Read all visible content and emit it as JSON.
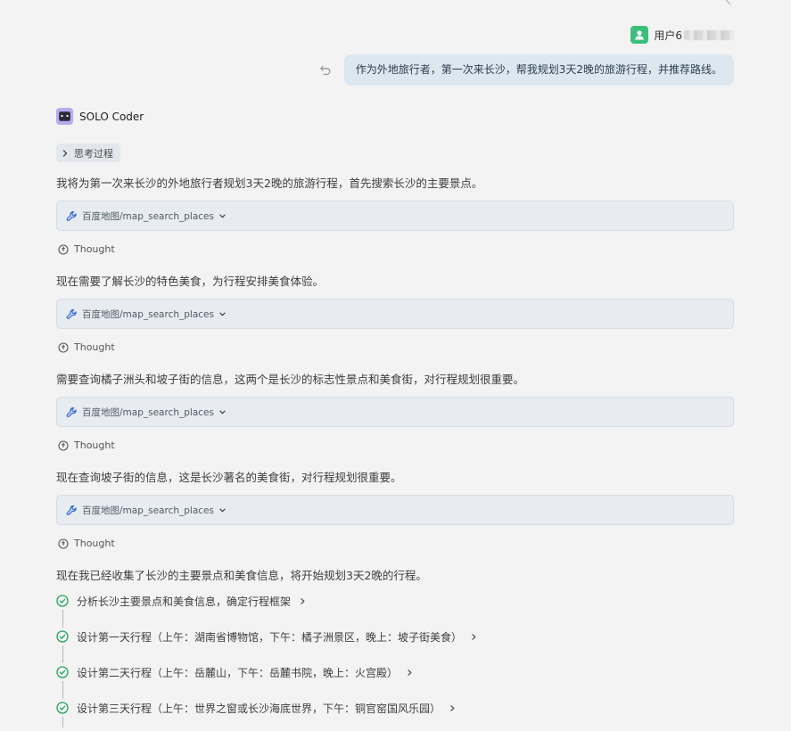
{
  "user": {
    "name": "用户6",
    "message": "作为外地旅行者，第一次来长沙，帮我规划3天2晚的旅游行程，并推荐路线。"
  },
  "agent": {
    "name": "SOLO Coder",
    "think_label": "思考过程"
  },
  "blocks": [
    {
      "text": "我将为第一次来长沙的外地旅行者规划3天2晚的旅游行程，首先搜索长沙的主要景点。",
      "tool": "百度地图/map_search_places",
      "thought": "Thought"
    },
    {
      "text": "现在需要了解长沙的特色美食，为行程安排美食体验。",
      "tool": "百度地图/map_search_places",
      "thought": "Thought"
    },
    {
      "text": "需要查询橘子洲头和坡子街的信息，这两个是长沙的标志性景点和美食街，对行程规划很重要。",
      "tool": "百度地图/map_search_places",
      "thought": "Thought"
    },
    {
      "text": "现在查询坡子街的信息，这是长沙著名的美食街，对行程规划很重要。",
      "tool": "百度地图/map_search_places",
      "thought": "Thought"
    }
  ],
  "final_text": "现在我已经收集了长沙的主要景点和美食信息，将开始规划3天2晚的行程。",
  "steps": [
    "分析长沙主要景点和美食信息，确定行程框架",
    "设计第一天行程（上午：湖南省博物馆，下午：橘子洲景区，晚上：坡子街美食）",
    "设计第二天行程（上午：岳麓山，下午：岳麓书院，晚上：火宫殿）",
    "设计第三天行程（上午：世界之窗或长沙海底世界，下午：铜官窑国风乐园）"
  ],
  "colors": {
    "check": "#20a35a",
    "user_avatar": "#3cbf7d",
    "agent_logo": "#b8a9f0",
    "bubble": "#dde7ef"
  }
}
